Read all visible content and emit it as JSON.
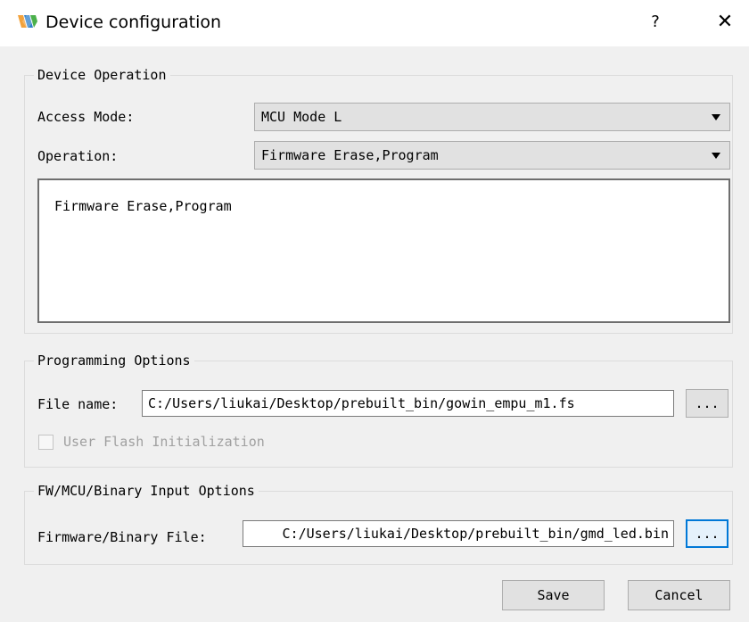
{
  "window": {
    "title": "Device configuration",
    "help_label": "?",
    "close_label": "✕",
    "logo_icon": "gowin-logo-icon",
    "logo_colors": [
      "#f2a23c",
      "#2f7fc8",
      "#4bb04b"
    ]
  },
  "device_operation": {
    "legend": "Device Operation",
    "access_mode_label": "Access Mode:",
    "access_mode_value": "MCU Mode L",
    "operation_label": "Operation:",
    "operation_value": "Firmware Erase,Program",
    "description": "Firmware Erase,Program"
  },
  "programming_options": {
    "legend": "Programming Options",
    "file_name_label": "File name:",
    "file_name_value": "C:/Users/liukai/Desktop/prebuilt_bin/gowin_empu_m1.fs",
    "browse_label": "...",
    "user_flash_label": "User Flash Initialization",
    "user_flash_checked": false
  },
  "input_options": {
    "legend": "FW/MCU/Binary Input Options",
    "firmware_label": "Firmware/Binary File:",
    "firmware_value": "C:/Users/liukai/Desktop/prebuilt_bin/gmd_led.bin",
    "browse_label": "..."
  },
  "footer": {
    "save_label": "Save",
    "cancel_label": "Cancel"
  },
  "colors": {
    "accent": "#0078d7",
    "background": "#f0f0f0"
  }
}
